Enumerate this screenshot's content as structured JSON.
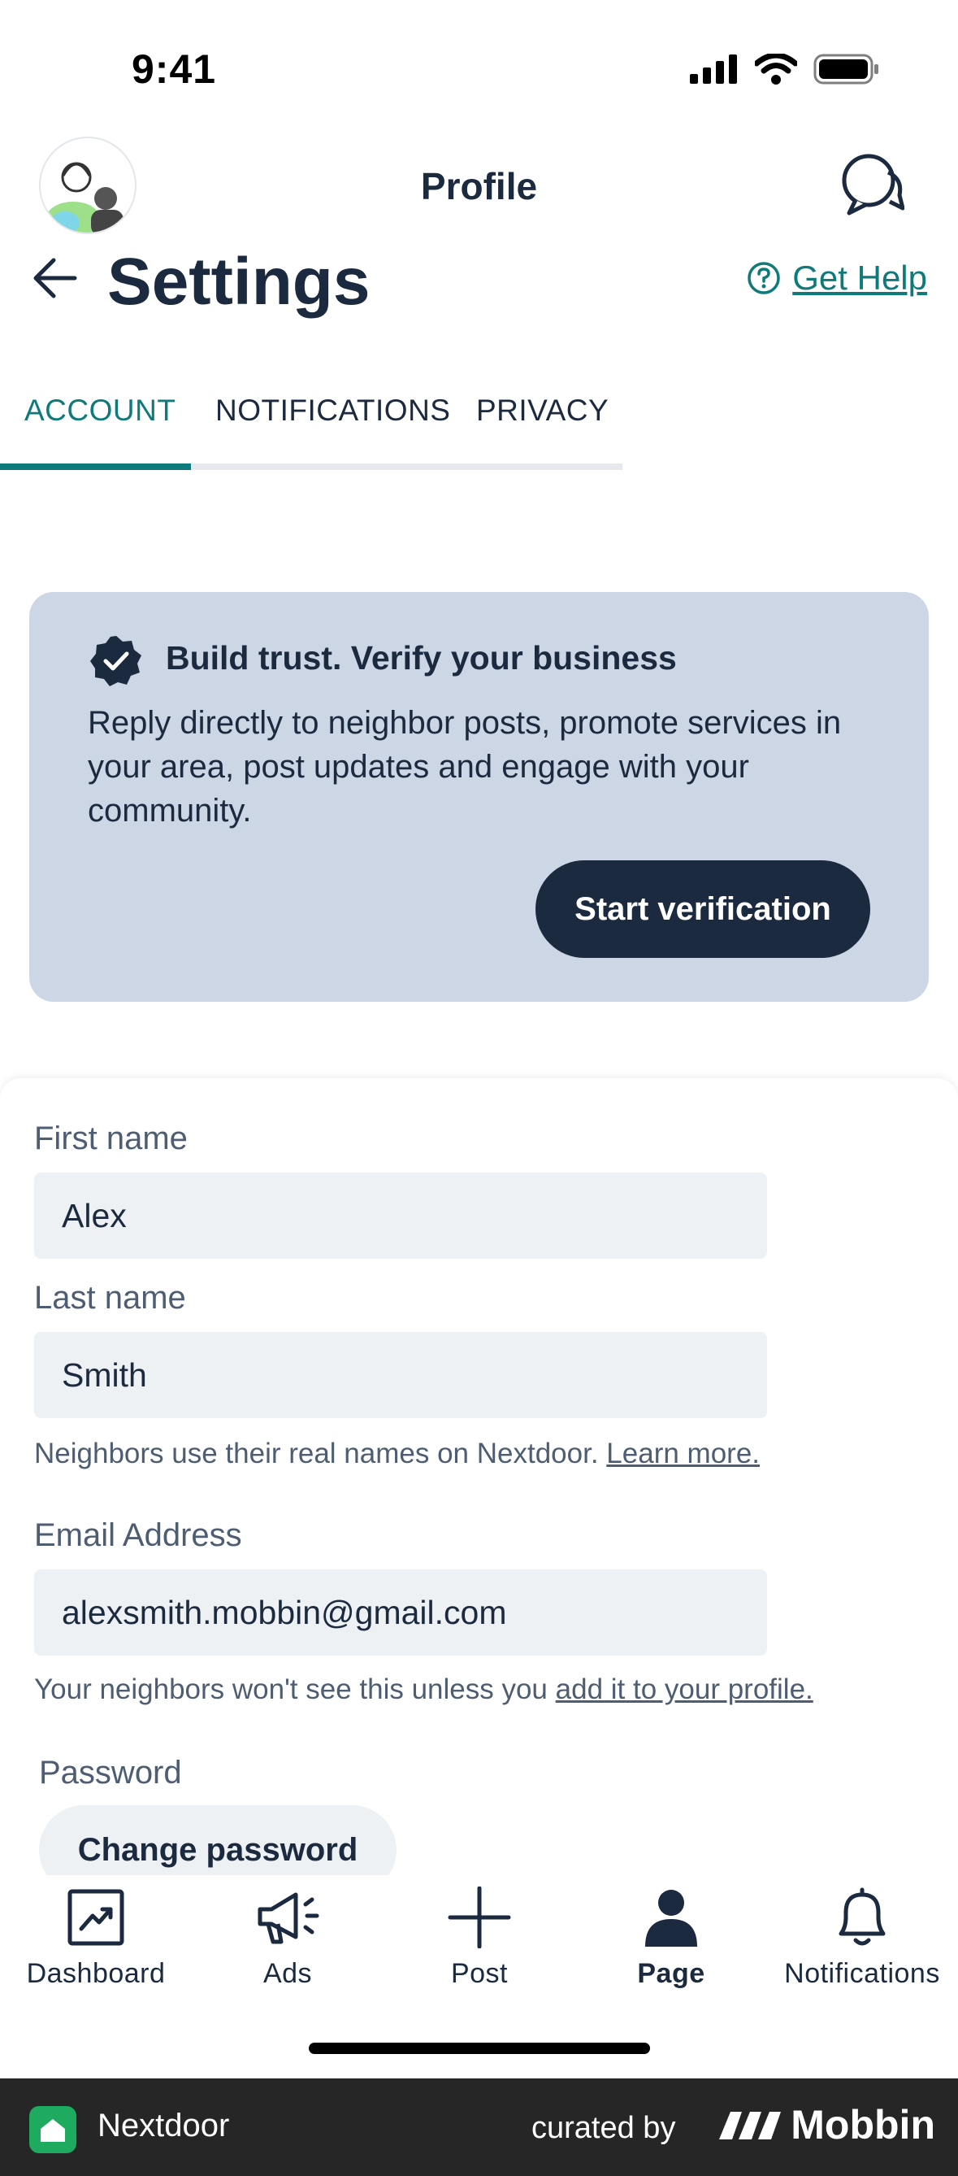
{
  "status_bar": {
    "time": "9:41"
  },
  "header": {
    "title": "Profile"
  },
  "settings": {
    "title": "Settings",
    "help_label": "Get Help"
  },
  "tabs": [
    {
      "label": "ACCOUNT",
      "active": true
    },
    {
      "label": "NOTIFICATIONS",
      "active": false
    },
    {
      "label": "PRIVACY",
      "active": false
    }
  ],
  "verify_card": {
    "title": "Build trust. Verify your business",
    "body": "Reply directly to neighbor posts, promote services in your area, post updates and engage with your community.",
    "button": "Start verification"
  },
  "form": {
    "first_name_label": "First name",
    "first_name_value": "Alex",
    "last_name_label": "Last name",
    "last_name_value": "Smith",
    "names_help_text": "Neighbors use their real names on Nextdoor.",
    "names_help_link": "Learn more.",
    "email_label": "Email Address",
    "email_value": "alexsmith.mobbin@gmail.com",
    "email_help_text": "Your neighbors won't see this unless you",
    "email_help_link": "add it to your profile.",
    "password_label": "Password",
    "password_button": "Change password"
  },
  "bottom_nav": [
    {
      "label": "Dashboard",
      "icon": "chart-icon",
      "active": false
    },
    {
      "label": "Ads",
      "icon": "megaphone-icon",
      "active": false
    },
    {
      "label": "Post",
      "icon": "plus-icon",
      "active": false
    },
    {
      "label": "Page",
      "icon": "person-icon",
      "active": true
    },
    {
      "label": "Notifications",
      "icon": "bell-icon",
      "active": false
    }
  ],
  "footer": {
    "app_name": "Nextdoor",
    "curated_by": "curated by",
    "brand": "Mobbin"
  },
  "colors": {
    "accent": "#0f7a7a",
    "navy": "#1b2a3f",
    "card_bg": "#cdd6e5",
    "input_bg": "#eef1f4"
  }
}
